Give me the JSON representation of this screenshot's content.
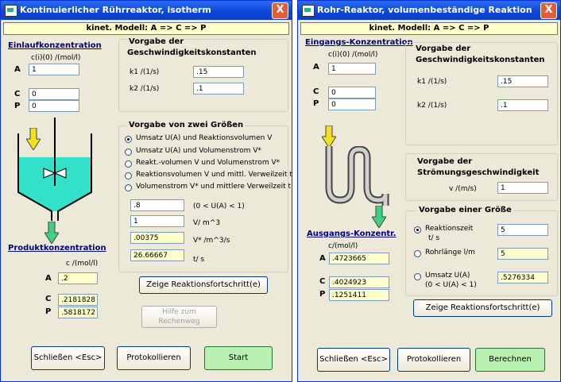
{
  "left": {
    "title": "Kontinuierlicher Rührreaktor, isotherm",
    "close": "X",
    "model": "kinet. Modell:  A => C => P",
    "inlet_head": "Einlaufkonzentration",
    "inlet_unit": "c(i)(0) /(mol/l)",
    "inlet_rows": [
      {
        "label": "A",
        "value": "1"
      },
      {
        "label": "C",
        "value": "0"
      },
      {
        "label": "P",
        "value": "0"
      }
    ],
    "rates_title1": "Vorgabe der",
    "rates_title2": "Geschwindigkeitskonstanten",
    "rates": [
      {
        "label": "k1  /(1/s)",
        "value": ".15"
      },
      {
        "label": "k2  /(1/s)",
        "value": ".1"
      }
    ],
    "two_title": "Vorgabe von zwei Größen",
    "options": [
      "Umsatz U(A) und Reaktionsvolumen V",
      "Umsatz U(A) und Volumenstrom V*",
      "Reakt.-volumen V und Volumenstrom V*",
      "Reaktionsvolumen V und mittl. Verweilzeit t",
      "Volumenstrom V* und mittlere Verweilzeit t"
    ],
    "selected_option": 0,
    "vals": [
      {
        "value": ".8",
        "label": "(0 < U(A) < 1)",
        "kind": "input"
      },
      {
        "value": "1",
        "label": "V/ m^3",
        "kind": "input"
      },
      {
        "value": ".00375",
        "label": "V* /m^3/s",
        "kind": "output"
      },
      {
        "value": "26.66667",
        "label": "t/    s",
        "kind": "output"
      }
    ],
    "product_head": "Produktkonzentration",
    "product_unit": "c /(mol/l)",
    "product_rows": [
      {
        "label": "A",
        "value": ".2"
      },
      {
        "label": "C",
        "value": ".2181828"
      },
      {
        "label": "P",
        "value": ".5818172"
      }
    ],
    "btn_steps": "Zeige Reaktionsfortschritt(e)",
    "btn_help1": "Hilfe zum",
    "btn_help2": "Rechenweg",
    "btn_close": "Schließen <Esc>",
    "btn_log": "Protokollieren",
    "btn_start": "Start"
  },
  "right": {
    "title": "Rohr-Reaktor, volumenbeständige Reaktion",
    "close": "X",
    "model": "kinet. Modell:  A => C => P",
    "inlet_head": "Eingangs-Konzentration",
    "inlet_unit": "c(i)(0) /(mol/l)",
    "inlet_rows": [
      {
        "label": "A",
        "value": "1"
      },
      {
        "label": "C",
        "value": "0"
      },
      {
        "label": "P",
        "value": "0"
      }
    ],
    "rates_title1": "Vorgabe der",
    "rates_title2": "Geschwindigkeitskonstanten",
    "rates": [
      {
        "label": "k1  /(1/s)",
        "value": ".15"
      },
      {
        "label": "k2  /(1/s)",
        "value": ".1"
      }
    ],
    "flow_title1": "Vorgabe der",
    "flow_title2": "Strömungsgeschwindigkeit",
    "flow_label": "v /(m/s)",
    "flow_value": "1",
    "one_title": "Vorgabe einer Größe",
    "options": [
      {
        "label1": "Reaktionszeit",
        "label2": "t/    s",
        "value": "5",
        "kind": "input"
      },
      {
        "label1": "Rohrlänge l/m",
        "label2": "",
        "value": "5",
        "kind": "output"
      },
      {
        "label1": "Umsatz U(A)",
        "label2": "(0 < U(A) < 1)",
        "value": ".5276334",
        "kind": "output"
      }
    ],
    "selected_option": 0,
    "outlet_head": "Ausgangs-Konzentr.",
    "outlet_unit": "c/(mol/l)",
    "outlet_rows": [
      {
        "label": "A",
        "value": ".4723665"
      },
      {
        "label": "C",
        "value": ".4024923"
      },
      {
        "label": "P",
        "value": ".1251411"
      }
    ],
    "btn_steps": "Zeige Reaktionsfortschritt(e)",
    "btn_close": "Schließen <Esc>",
    "btn_log": "Protokollieren",
    "btn_calc": "Berechnen"
  },
  "colors": {
    "title_blue": "#0a46d8",
    "window_bg": "#ece9d8",
    "output_bg": "#ffffcc",
    "liquid": "#33e0c8",
    "arrow_in": "#f0e020",
    "arrow_out": "#40d080",
    "start_btn": "#b7f0b0"
  }
}
